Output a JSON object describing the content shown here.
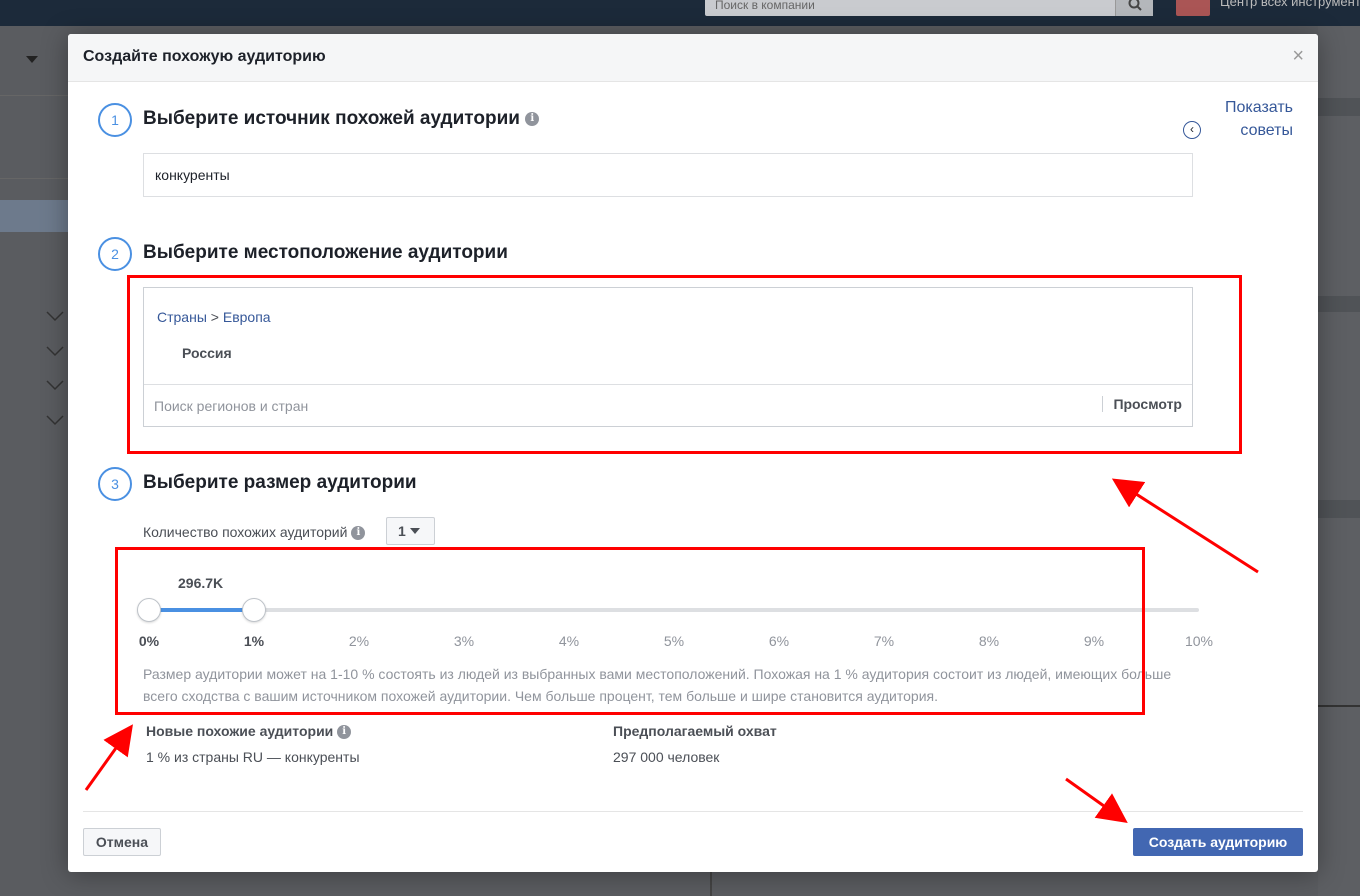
{
  "background": {
    "search_placeholder": "Поиск в компании",
    "header_link": "Центр всех инструментов"
  },
  "modal": {
    "title": "Создайте похожую аудиторию",
    "close_glyph": "×"
  },
  "tips": {
    "label": "Показать советы",
    "chevron_glyph": "‹"
  },
  "step1": {
    "number": "1",
    "title": "Выберите источник похожей аудитории",
    "info_glyph": "i",
    "source_value": "конкуренты"
  },
  "step2": {
    "number": "2",
    "title": "Выберите местоположение аудитории",
    "crumb_countries": "Страны",
    "crumb_separator": " > ",
    "crumb_region": "Европа",
    "selected_country": "Россия",
    "search_placeholder": "Поиск регионов и стран",
    "browse_label": "Просмотр"
  },
  "step3": {
    "number": "3",
    "title": "Выберите размер аудитории",
    "count_label": "Количество похожих аудиторий",
    "count_value": "1",
    "slider_value_label": "296.7K",
    "slider_start_percent": 0,
    "slider_end_percent": 1,
    "slider_max_percent": 10,
    "ticks": [
      "0%",
      "1%",
      "2%",
      "3%",
      "4%",
      "5%",
      "6%",
      "7%",
      "8%",
      "9%",
      "10%"
    ],
    "description": "Размер аудитории может на 1-10 % состоять из людей из выбранных вами местоположений. Похожая на 1 % аудитория состоит из людей, имеющих больше всего сходства с вашим источником похожей аудитории. Чем больше процент, тем больше и шире становится аудитория."
  },
  "summary": {
    "new_audiences_label": "Новые похожие аудитории",
    "new_audiences_value": "1 % из страны RU — конкуренты",
    "reach_label": "Предполагаемый охват",
    "reach_value": "297 000 человек"
  },
  "footer": {
    "cancel_label": "Отмена",
    "create_label": "Создать аудиторию"
  },
  "colors": {
    "accent": "#4a90e2",
    "primary_button": "#4267b2",
    "link": "#365899",
    "annotation": "#ff0000"
  }
}
